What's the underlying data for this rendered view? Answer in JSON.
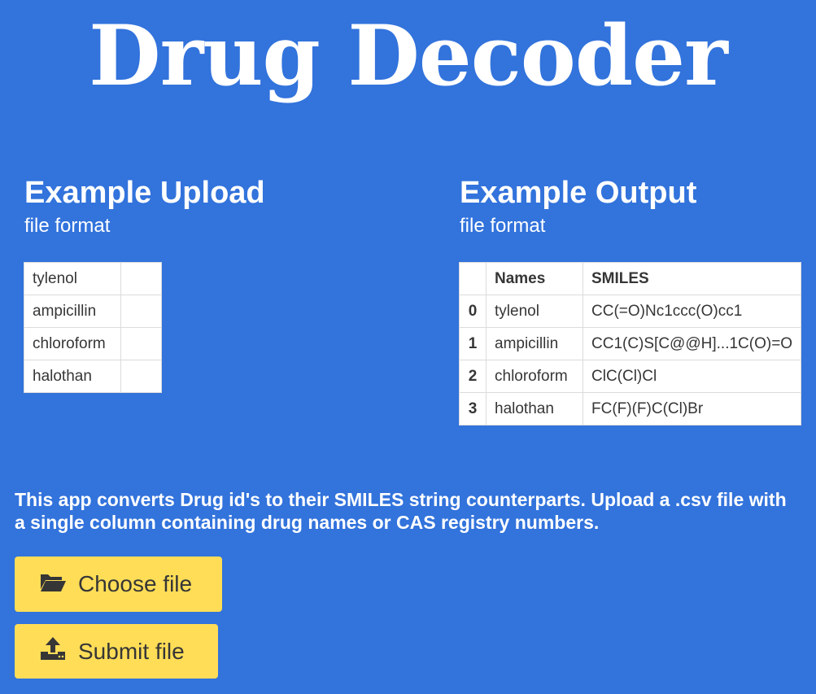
{
  "app": {
    "title": "Drug Decoder"
  },
  "upload_example": {
    "heading": "Example Upload",
    "subheading": "file format",
    "rows": [
      "tylenol",
      "ampicillin",
      "chloroform",
      "halothan"
    ]
  },
  "output_example": {
    "heading": "Example Output",
    "subheading": "file format",
    "columns": [
      "",
      "Names",
      "SMILES"
    ],
    "rows": [
      {
        "index": "0",
        "name": "tylenol",
        "smiles": "CC(=O)Nc1ccc(O)cc1"
      },
      {
        "index": "1",
        "name": "ampicillin",
        "smiles": "CC1(C)S[C@@H]...1C(O)=O"
      },
      {
        "index": "2",
        "name": "chloroform",
        "smiles": "ClC(Cl)Cl"
      },
      {
        "index": "3",
        "name": "halothan",
        "smiles": "FC(F)(F)C(Cl)Br"
      }
    ]
  },
  "description": "This app converts Drug id's to their SMILES string counterparts. Upload a .csv file with a single column containing drug names or CAS registry numbers.",
  "buttons": {
    "choose_label": "Choose file",
    "choose_icon": "folder-open-icon",
    "submit_label": "Submit file",
    "submit_icon": "upload-icon"
  },
  "colors": {
    "background": "#3273dc",
    "button": "#ffdd57",
    "text": "#ffffff"
  }
}
